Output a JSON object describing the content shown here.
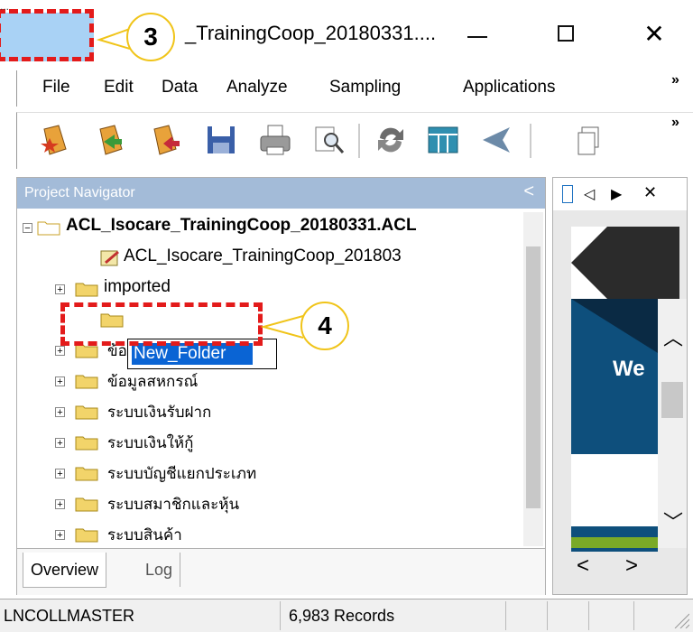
{
  "window": {
    "title": "_TrainingCoop_20180331....",
    "top_left_text": "..."
  },
  "callouts": {
    "step3": "3",
    "step4": "4"
  },
  "menu": {
    "items": [
      "File",
      "Edit",
      "Data",
      "Analyze",
      "Sampling",
      "Applications"
    ],
    "overflow": "»"
  },
  "toolbar": {
    "icons": [
      "new-project-icon",
      "open-project-icon",
      "open-table-icon",
      "save-icon",
      "print-icon",
      "find-icon",
      "refresh-icon",
      "table-layout-icon",
      "filter-icon",
      "copy-icon"
    ],
    "overflow": "»"
  },
  "navigator": {
    "header": "Project Navigator",
    "collapse": "<",
    "project": "ACL_Isocare_TrainingCoop_20180331.ACL",
    "log_item": "ACL_Isocare_TrainingCoop_201803",
    "folders": [
      "imported",
      "New_Folder",
      "ข้อมูลผู้ใช้งาน",
      "ข้อมูลสหกรณ์",
      "ระบบเงินรับฝาก",
      "ระบบเงินให้กู้",
      "ระบบบัญชีแยกประเภท",
      "ระบบสมาชิกและหุ้น",
      "ระบบสินค้า"
    ],
    "tabs": [
      "Overview",
      "Log"
    ]
  },
  "right_panel": {
    "tab_controls": [
      "◁",
      "▶",
      "✕"
    ],
    "welcome_text": "We",
    "nav": [
      "<",
      ">"
    ]
  },
  "status": {
    "table": "LNCOLLMASTER",
    "records": "6,983 Records"
  },
  "colors": {
    "nav_header": "#a3bbd8",
    "selection": "#0a64d4",
    "highlight_dash": "#e31b1b",
    "callout_border": "#f0c419"
  }
}
